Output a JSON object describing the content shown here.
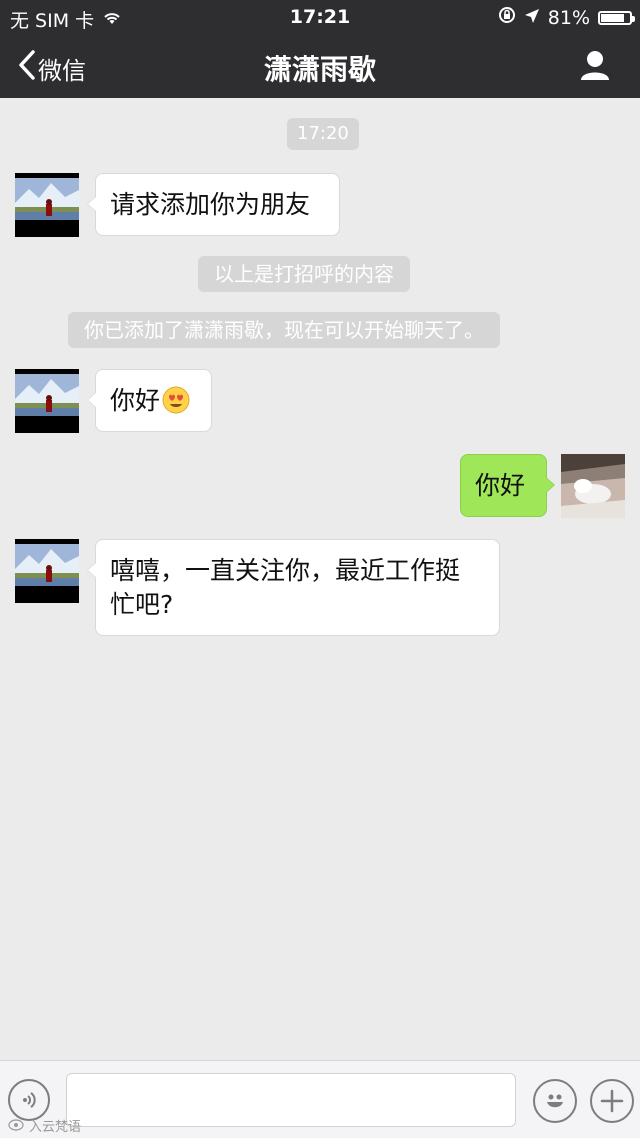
{
  "status_bar": {
    "carrier": "无 SIM 卡",
    "time": "17:21",
    "battery_text": "81%",
    "battery_level": 0.81,
    "icons": [
      "wifi-icon",
      "orientation-lock-icon",
      "location-arrow-icon",
      "battery-icon"
    ]
  },
  "nav": {
    "back_label": "微信",
    "title": "潇潇雨歇",
    "right_icon": "user-profile-icon"
  },
  "chat": {
    "timestamp": "17:20",
    "messages": [
      {
        "side": "left",
        "text": "请求添加你为朋友"
      },
      {
        "side": "system",
        "text": "以上是打招呼的内容"
      },
      {
        "side": "system",
        "text": "你已添加了潇潇雨歇，现在可以开始聊天了。"
      },
      {
        "side": "left",
        "text": "你好",
        "emoji": "smiling-heart-eyes-emoji"
      },
      {
        "side": "right",
        "text": "你好"
      },
      {
        "side": "left",
        "text_line1": "嘻嘻，一直关注你，最近工作挺",
        "text_line2": "忙吧?"
      }
    ]
  },
  "input_bar": {
    "placeholder": "",
    "icons": [
      "voice-icon",
      "emoji-icon",
      "plus-icon"
    ]
  },
  "watermark": {
    "text": "入云梵语"
  },
  "colors": {
    "nav_bg": "#2e2e31",
    "chat_bg": "#ebebeb",
    "sent_bubble": "#9fe658",
    "received_bubble": "#ffffff"
  }
}
